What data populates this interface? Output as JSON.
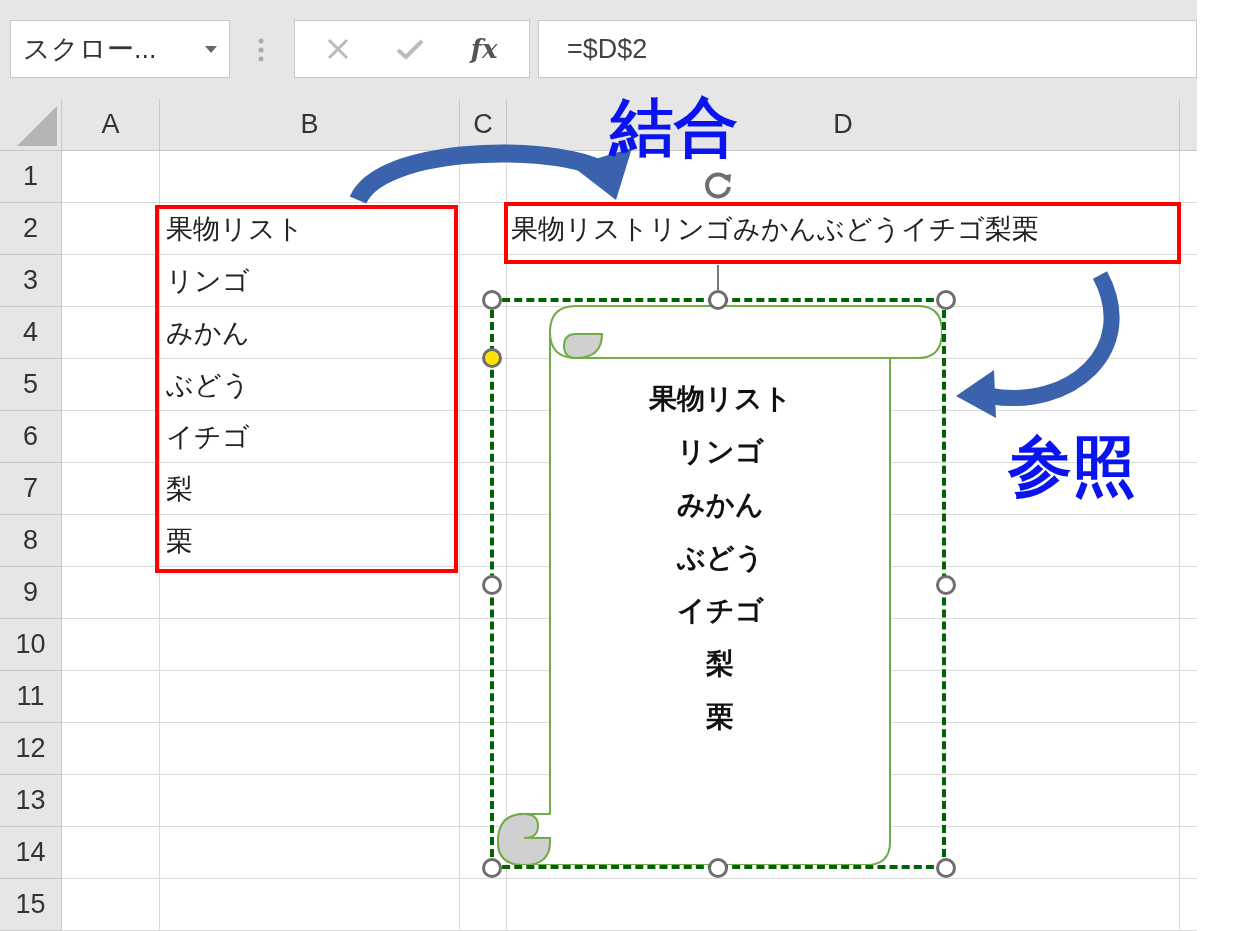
{
  "name_box": {
    "value": "スクロー..."
  },
  "formula_bar": {
    "function_label": "fx",
    "formula": "=$D$2"
  },
  "columns": [
    "A",
    "B",
    "C",
    "D"
  ],
  "rows": [
    {
      "header": "1"
    },
    {
      "header": "2",
      "b": "果物リスト",
      "d": "果物リストリンゴみかんぶどうイチゴ梨栗"
    },
    {
      "header": "3",
      "b": "リンゴ"
    },
    {
      "header": "4",
      "b": "みかん"
    },
    {
      "header": "5",
      "b": "ぶどう"
    },
    {
      "header": "6",
      "b": "イチゴ"
    },
    {
      "header": "7",
      "b": "梨"
    },
    {
      "header": "8",
      "b": "栗"
    },
    {
      "header": "9"
    },
    {
      "header": "10"
    },
    {
      "header": "11"
    },
    {
      "header": "12"
    },
    {
      "header": "13"
    },
    {
      "header": "14"
    },
    {
      "header": "15"
    }
  ],
  "shape": {
    "kind": "scroll",
    "selected": true,
    "lines": [
      "果物リスト",
      "リンゴ",
      "みかん",
      "ぶどう",
      "イチゴ",
      "梨",
      "栗"
    ]
  },
  "annotations": {
    "merge_label": "結合",
    "reference_label": "参照"
  }
}
